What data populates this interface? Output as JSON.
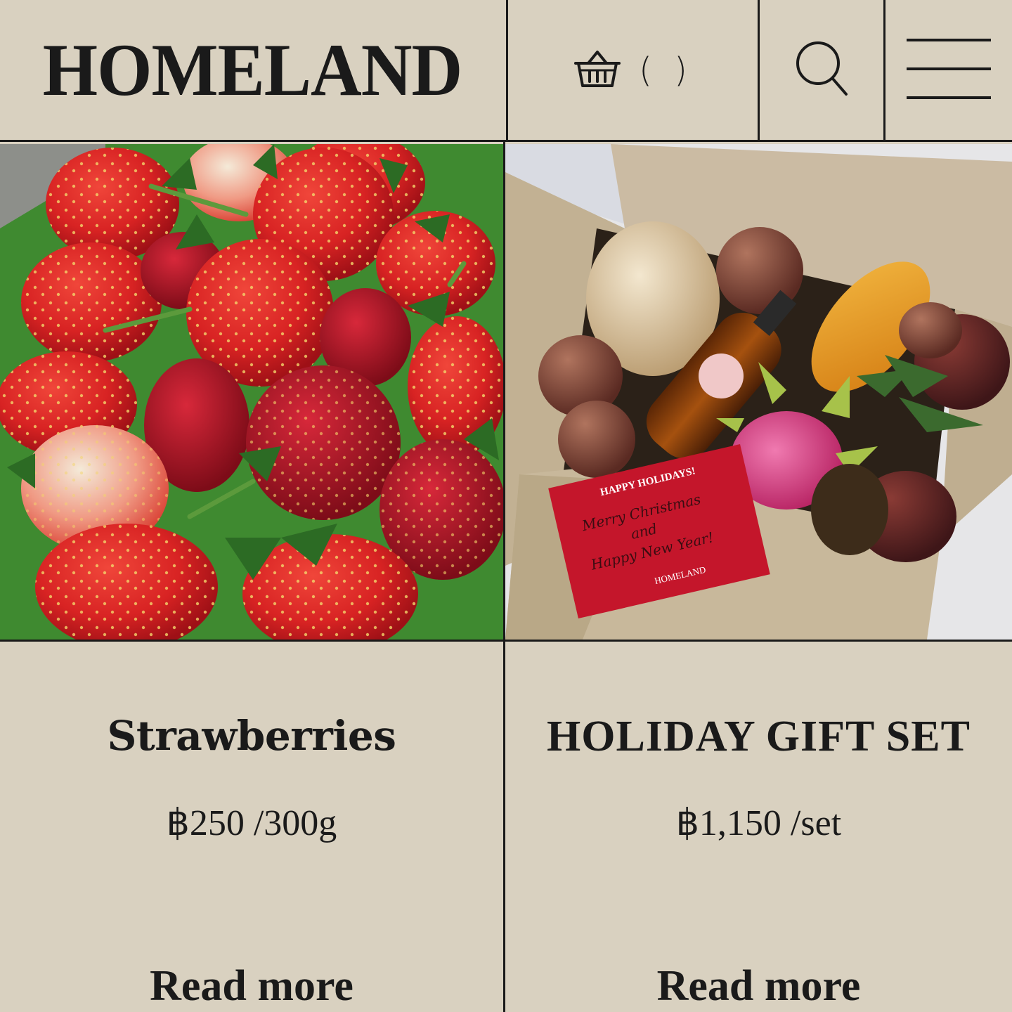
{
  "header": {
    "logo": "HOMELAND",
    "cart_count": "( )",
    "cart_icon": "basket-icon",
    "search_icon": "search-icon",
    "menu_icon": "hamburger-menu-icon"
  },
  "products": [
    {
      "name": "Strawberries",
      "price": "฿250 /300g",
      "read_more": "Read more",
      "image": "strawberries-photo"
    },
    {
      "name": "HOLIDAY GIFT SET",
      "price": "฿1,150 /set",
      "read_more": "Read more",
      "image": "gift-box-photo",
      "card_text": {
        "heading": "HAPPY HOLIDAYS!",
        "line1": "Merry Christmas",
        "line2": "and",
        "line3": "Happy New Year!",
        "brand": "HOMELAND"
      }
    }
  ],
  "colors": {
    "background": "#d9d1c0",
    "ink": "#1a1a1a",
    "card_red": "#c4162b"
  }
}
